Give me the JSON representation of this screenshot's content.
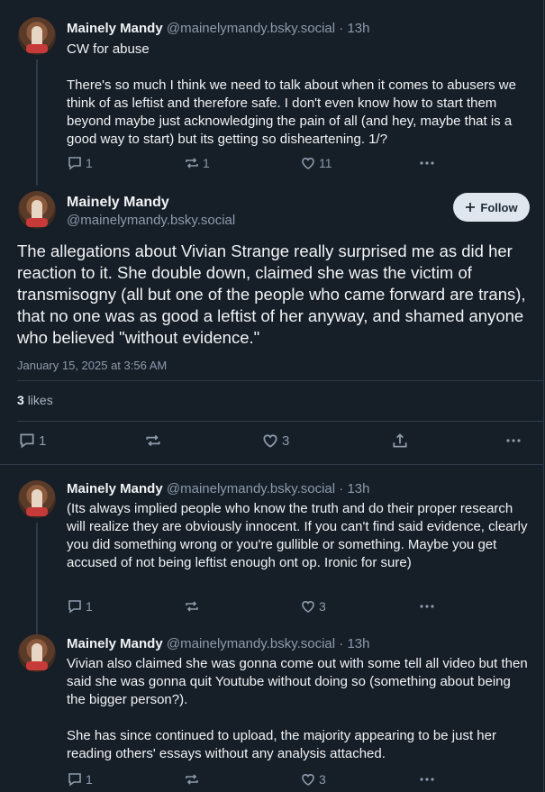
{
  "posts": [
    {
      "author": "Mainely Mandy",
      "handle": "@mainelymandy.bsky.social",
      "time": "· 13h",
      "text": "CW for abuse\n\nThere's so much I think we need to talk about when it comes to abusers we think of as leftist and therefore safe. I don't even know how to start them beyond maybe just acknowledging the pain of all (and hey, maybe that is a good way to start) but its getting so disheartening. 1/?",
      "replies": "1",
      "reposts": "1",
      "likes": "11"
    }
  ],
  "focused": {
    "author": "Mainely Mandy",
    "handle": "@mainelymandy.bsky.social",
    "follow_label": "Follow",
    "text": "The allegations about Vivian Strange really surprised me as did her reaction to it. She double down, claimed she was the victim of transmisogny (all but one of the people who came forward are trans), that no one was as good a leftist of her anyway, and shamed anyone who believed \"without evidence.\"",
    "date": "January 15, 2025 at 3:56 AM",
    "likes_count": "3",
    "likes_label": "likes",
    "replies": "1",
    "likes": "3"
  },
  "replies": [
    {
      "author": "Mainely Mandy",
      "handle": "@mainelymandy.bsky.social",
      "time": "· 13h",
      "text": "(Its always implied people who know the truth and do their proper research will realize they are obviously innocent. If you can't find said evidence, clearly you did something wrong or you're gullible or something. Maybe you get accused of not being leftist enough ont op. Ironic for sure)",
      "replies": "1",
      "likes": "3"
    },
    {
      "author": "Mainely Mandy",
      "handle": "@mainelymandy.bsky.social",
      "time": "· 13h",
      "text": "Vivian also claimed she was gonna come out with some tell all video but then said she was gonna quit Youtube without doing so (something about being the bigger person?).\n\nShe has since continued to upload, the majority appearing to be just her reading others' essays without any analysis attached.",
      "replies": "1",
      "likes": "3"
    }
  ],
  "icons": {
    "reply": "speech-bubble-icon",
    "repost": "repost-arrows-icon",
    "like": "heart-icon",
    "share": "share-upload-icon",
    "more": "ellipsis-icon",
    "follow": "plus-icon"
  },
  "colors": {
    "background": "#161e27",
    "muted": "#8d9bad",
    "divider": "#2e3a48"
  }
}
